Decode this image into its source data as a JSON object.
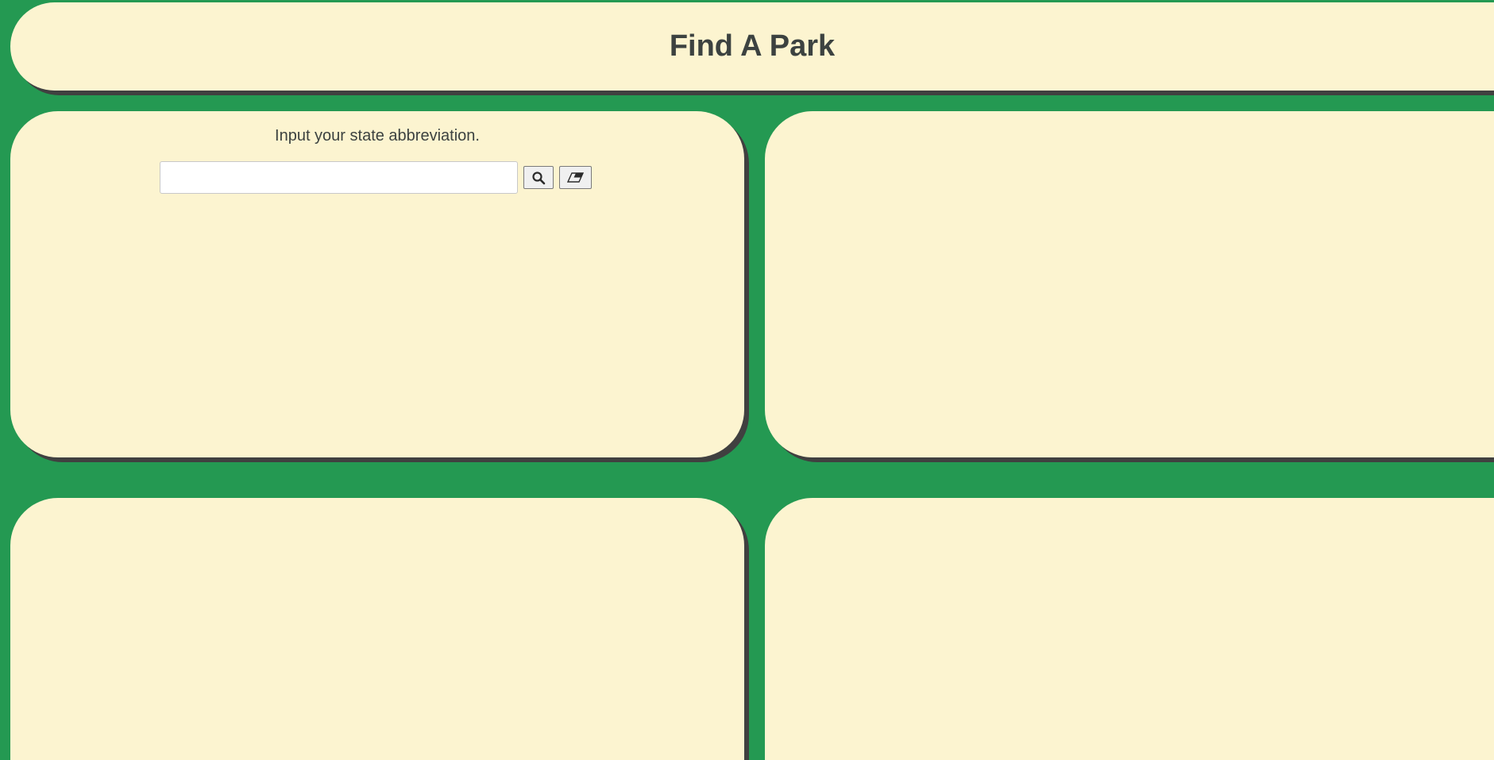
{
  "header": {
    "title": "Find A Park"
  },
  "search_panel": {
    "prompt": "Input your state abbreviation.",
    "input": {
      "value": "",
      "placeholder": ""
    },
    "search_button_icon": "search-icon",
    "clear_button_icon": "eraser-icon"
  },
  "colors": {
    "background": "#249952",
    "panel": "#fcf4d0",
    "shadow": "#404040",
    "text": "#3c4240"
  }
}
